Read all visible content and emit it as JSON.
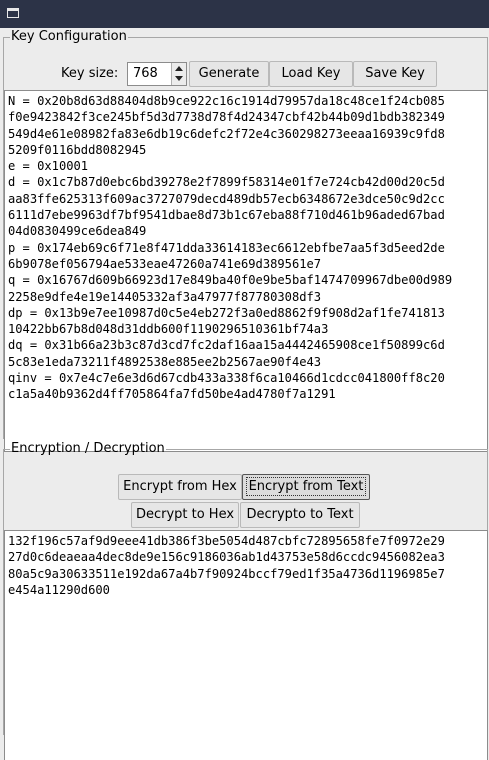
{
  "window": {
    "title": ""
  },
  "key_config": {
    "legend": "Key Configuration",
    "key_size_label": "Key size:",
    "key_size_value": "768",
    "generate_label": "Generate",
    "load_key_label": "Load Key",
    "save_key_label": "Save Key",
    "key_lines": [
      "N = 0x20b8d63d88404d8b9ce922c16c1914d79957da18c48ce1f24cb085",
      "f0e9423842f3ce245bf5d3d7738d78f4d24347cbf42b44b09d1bdb382349",
      "549d4e61e08982fa83e6db19c6defc2f72e4c360298273eeaa16939c9fd8",
      "5209f0116bdd8082945",
      "e = 0x10001",
      "d = 0x1c7b87d0ebc6bd39278e2f7899f58314e01f7e724cb42d00d20c5d",
      "aa83ffe625313f609ac3727079decd489db57ecb6348672e3dce50c9d2cc",
      "6111d7ebe9963df7bf9541dbae8d73b1c67eba88f710d461b96aded67bad",
      "04d0830499ce6dea849",
      "p = 0x174eb69c6f71e8f471dda33614183ec6612ebfbe7aa5f3d5eed2de",
      "6b9078ef056794ae533eae47260a741e69d389561e7",
      "q = 0x16767d609b66923d17e849ba40f0e9be5baf1474709967dbe00d989",
      "2258e9dfe4e19e14405332af3a47977f87780308df3",
      "dp = 0x13b9e7ee10987d0c5e4eb272f3a0ed8862f9f908d2af1fe741813",
      "10422bb67b8d048d31ddb600f1190296510361bf74a3",
      "dq = 0x31b66a23b3c87d3cd7fc2daf16aa15a4442465908ce1f50899c6d",
      "5c83e1eda73211f4892538e885ee2b2567ae90f4e43",
      "qinv = 0x7e4c7e6e3d6d67cdb433a338f6ca10466d1cdcc041800ff8c20",
      "c1a5a40b9362d4ff705864fa7fd50be4ad4780f7a1291"
    ]
  },
  "encdec": {
    "legend": "Encryption / Decryption",
    "encrypt_hex_label": "Encrypt from Hex",
    "encrypt_text_label": "Encrypt from Text",
    "decrypt_hex_label": "Decrypt to Hex",
    "decrypt_text_label": "Decrypto to Text",
    "output_lines": [
      "132f196c57af9d9eee41db386f3be5054d487cbfc72895658fe7f0972e29",
      "27d0c6deaeaa4dec8de9e156c9186036ab1d43753e58d6ccdc9456082ea3",
      "80a5c9a30633511e192da67a4b7f90924bccf79ed1f35a4736d1196985e7",
      "e454a11290d600"
    ]
  }
}
